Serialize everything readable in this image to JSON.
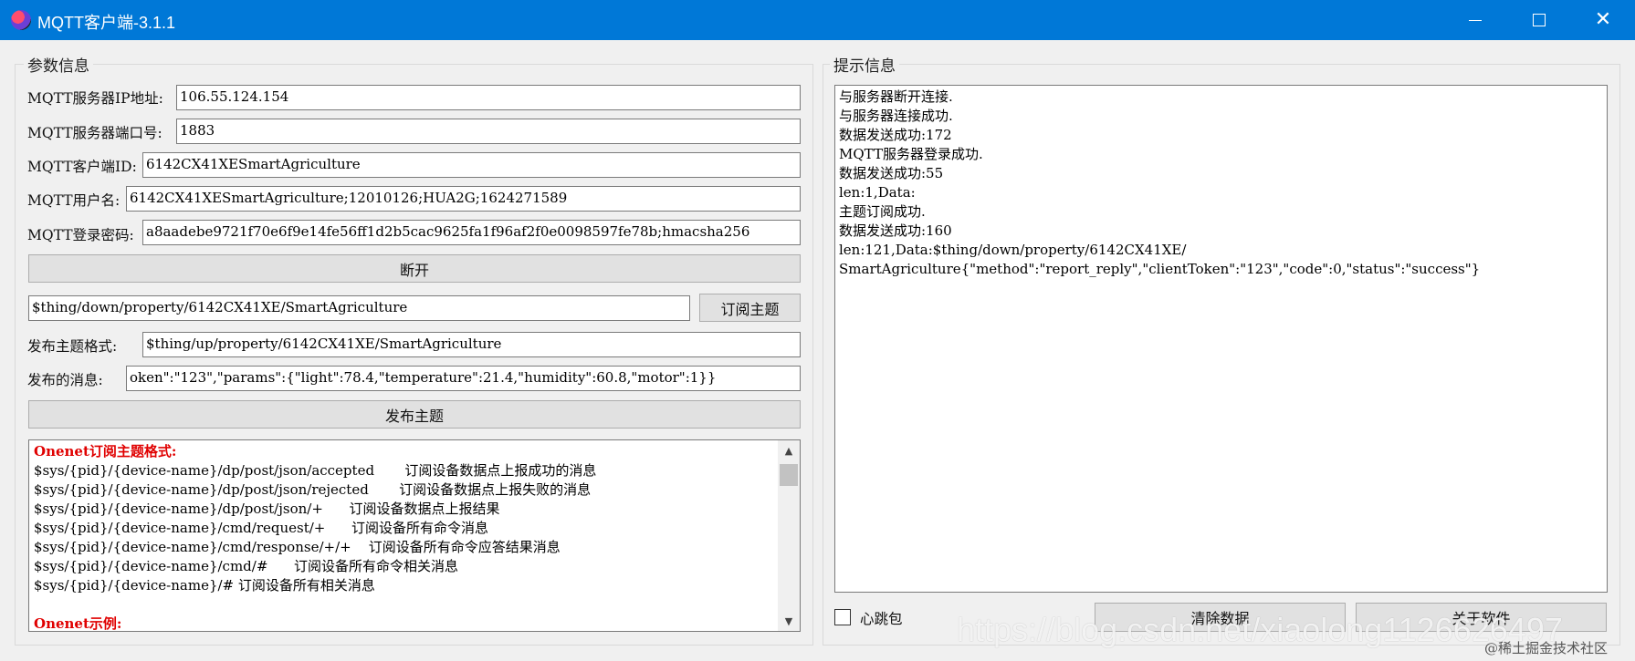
{
  "window": {
    "title": "MQTT客户端-3.1.1"
  },
  "params": {
    "group_label": "参数信息",
    "ip_label": "MQTT服务器IP地址:",
    "ip_value": "106.55.124.154",
    "port_label": "MQTT服务器端口号:",
    "port_value": "1883",
    "client_id_label": "MQTT客户端ID:",
    "client_id_value": "6142CX41XESmartAgriculture",
    "username_label": "MQTT用户名:",
    "username_value": "6142CX41XESmartAgriculture;12010126;HUA2G;1624271589",
    "password_label": "MQTT登录密码:",
    "password_value": "a8aadebe9721f70e6f9e14fe56ff1d2b5cac9625fa1f96af2f0e0098597fe78b;hmacsha256",
    "disconnect_button": "断开",
    "subscribe_topic_value": "$thing/down/property/6142CX41XE/SmartAgriculture",
    "subscribe_button": "订阅主题",
    "publish_topic_label": "发布主题格式:",
    "publish_topic_value": "$thing/up/property/6142CX41XE/SmartAgriculture",
    "publish_message_label": "发布的消息:",
    "publish_message_value": "oken\":\"123\",\"params\":{\"light\":78.4,\"temperature\":21.4,\"humidity\":60.8,\"motor\":1}}",
    "publish_button": "发布主题"
  },
  "reference_text": {
    "heading": "Onenet订阅主题格式:",
    "lines": [
      "$sys/{pid}/{device-name}/dp/post/json/accepted       订阅设备数据点上报成功的消息",
      "$sys/{pid}/{device-name}/dp/post/json/rejected       订阅设备数据点上报失败的消息",
      "$sys/{pid}/{device-name}/dp/post/json/+      订阅设备数据点上报结果",
      "$sys/{pid}/{device-name}/cmd/request/+      订阅设备所有命令消息",
      "$sys/{pid}/{device-name}/cmd/response/+/+    订阅设备所有命令应答结果消息",
      "$sys/{pid}/{device-name}/cmd/#      订阅设备所有命令相关消息",
      "$sys/{pid}/{device-name}/# 订阅设备所有相关消息"
    ],
    "example_heading": "Onenet示例:"
  },
  "log": {
    "group_label": "提示信息",
    "lines": [
      "与服务器断开连接.",
      "与服务器连接成功.",
      "数据发送成功:172",
      "MQTT服务器登录成功.",
      "数据发送成功:55",
      "len:1,Data:",
      "主题订阅成功.",
      "数据发送成功:160",
      "len:121,Data:$thing/down/property/6142CX41XE/",
      "SmartAgriculture{\"method\":\"report_reply\",\"clientToken\":\"123\",\"code\":0,\"status\":\"success\"}"
    ],
    "heartbeat_label": "心跳包",
    "clear_button": "清除数据",
    "about_button": "关于软件"
  },
  "watermark": {
    "url": "https://blog.csdn.net/xiaolong1126626497",
    "site": "@稀土掘金技术社区"
  }
}
